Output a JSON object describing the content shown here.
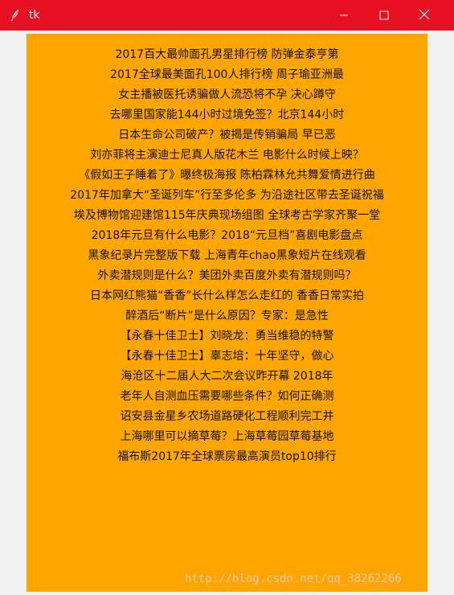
{
  "window": {
    "title": "tk",
    "titlebar_color": "#e81123",
    "icon": "feather-icon",
    "controls": [
      "minimize-icon",
      "maximize-icon",
      "close-icon"
    ]
  },
  "label": {
    "background": "#ffa500",
    "lines": [
      "2017百大最帅面孔男星排行榜 防弹金泰亨第",
      "2017全球最美面孔100人排行榜 周子瑜亚洲最",
      "女主播被医托诱骗做人流恐将不孕 决心蹲守",
      "去哪里国家能144小时过境免签？北京144小时",
      "日本生命公司破产？被揭是传销骗局 早已恶",
      "刘亦菲将主演迪士尼真人版花木兰 电影什么时候上映？",
      "《假如王子睡着了》曝终极海报 陈柏霖林允共舞爱情进行曲",
      "2017年加拿大“圣诞列车”行至多伦多 为沿途社区带去圣诞祝福",
      "埃及博物馆迎建馆115年庆典现场组图 全球考古学家齐聚一堂",
      "2018年元旦有什么电影？2018“元旦档”喜剧电影盘点",
      "黑象纪录片完整版下载 上海青年chao黑象短片在线观看",
      "外卖潜规则是什么？美团外卖百度外卖有潜规则吗？",
      "日本网红熊猫“香香”长什么样怎么走红的 香香日常实拍",
      "醉酒后“断片”是什么原因？专家：是急性",
      "【永春十佳卫士】刘晓龙：勇当维稳的特警",
      "【永春十佳卫士】辜志培：十年坚守，做心",
      "海沧区十二届人大二次会议昨开幕 2018年",
      "老年人自测血压需要哪些条件？如何正确测",
      "诏安县金星乡农场道路硬化工程顺利完工并",
      "上海哪里可以摘草莓？上海草莓园草莓基地",
      "福布斯2017年全球票房最高演员top10排行"
    ]
  },
  "watermark": "http://blog.csdn.net/qq_38262266"
}
